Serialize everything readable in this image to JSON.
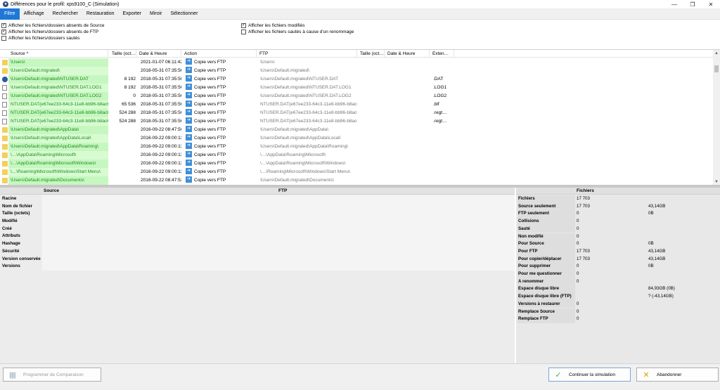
{
  "window": {
    "title": "Différences pour le profil: xps9100_C (Simulation)",
    "controls": [
      "—",
      "❐",
      "✕"
    ]
  },
  "menu": [
    "Filtre",
    "Affichage",
    "Rechercher",
    "Restauration",
    "Exporter",
    "Miroir",
    "Sélectionner"
  ],
  "filters": {
    "left": [
      {
        "label": "Afficher les fichiers/dossiers absents de Source",
        "checked": true
      },
      {
        "label": "Afficher les fichiers/dossiers absents de FTP",
        "checked": true
      },
      {
        "label": "Afficher les fichiers/dossiers sautés",
        "checked": false
      }
    ],
    "right": [
      {
        "label": "Afficher les fichiers modifiés",
        "checked": true
      },
      {
        "label": "Afficher les fichiers sautés à cause d'un renommage",
        "checked": false
      }
    ]
  },
  "grid": {
    "columns": [
      "Source",
      "Taille (oct…",
      "Date & Heure",
      "Action",
      "FTP",
      "Taille (oct…",
      "Date & Heure",
      "Exten…"
    ],
    "sort_indicator": "^",
    "rows": [
      {
        "icon": "folder",
        "source": "\\Users\\",
        "size": "",
        "date": "2021-01-07 06:11:42",
        "action": "Copie vers FTP",
        "ftp": "\\Users\\",
        "ext": ""
      },
      {
        "icon": "folder",
        "source": "\\Users\\Default.migrated\\",
        "size": "",
        "date": "2018-05-31 07:35:56",
        "action": "Copie vers FTP",
        "ftp": "\\Users\\Default.migrated\\",
        "ext": ""
      },
      {
        "icon": "user",
        "source": "\\Users\\Default.migrated\\NTUSER.DAT",
        "size": "8 192",
        "date": "2018-05-31 07:35:56",
        "action": "Copie vers FTP",
        "ftp": "\\Users\\Default.migrated\\NTUSER.DAT",
        "ext": ".DAT"
      },
      {
        "icon": "file",
        "source": "\\Users\\Default.migrated\\NTUSER.DAT.LOG1",
        "size": "8 192",
        "date": "2018-05-31 07:35:56",
        "action": "Copie vers FTP",
        "ftp": "\\Users\\Default.migrated\\NTUSER.DAT.LOG1",
        "ext": ".LOG1"
      },
      {
        "icon": "file",
        "source": "\\Users\\Default.migrated\\NTUSER.DAT.LOG2",
        "size": "0",
        "date": "2018-05-31 07:35:56",
        "action": "Copie vers FTP",
        "ftp": "\\Users\\Default.migrated\\NTUSER.DAT.LOG2",
        "ext": ".LOG2"
      },
      {
        "icon": "file",
        "source": "NTUSER.DAT{e67ee233-64c3-11e8-bb96-b8ac6f",
        "size": "65 536",
        "date": "2018-05-31 07:35:56",
        "action": "Copie vers FTP",
        "ftp": "NTUSER.DAT{e67ee233-64c3-11e8-bb96-b8ac6f",
        "ext": ".blf"
      },
      {
        "icon": "file",
        "source": "NTUSER.DAT{e67ee233-64c3-11e8-bb96-b8ac6f",
        "size": "524 288",
        "date": "2018-05-31 07:35:56",
        "action": "Copie vers FTP",
        "ftp": "NTUSER.DAT{e67ee233-64c3-11e8-bb96-b8ac6f",
        "ext": ".regt…"
      },
      {
        "icon": "file",
        "source": "NTUSER.DAT{e67ee233-64c3-11e8-bb96-b8ac6f",
        "size": "524 288",
        "date": "2018-05-31 07:35:56",
        "action": "Copie vers FTP",
        "ftp": "NTUSER.DAT{e67ee233-64c3-11e8-bb96-b8ac6f",
        "ext": ".regt…"
      },
      {
        "icon": "folder",
        "source": "\\Users\\Default.migrated\\AppData\\",
        "size": "",
        "date": "2016-09-22 08:47:50",
        "action": "Copie vers FTP",
        "ftp": "\\Users\\Default.migrated\\AppData\\",
        "ext": ""
      },
      {
        "icon": "folder",
        "source": "\\Users\\Default.migrated\\AppData\\Local\\",
        "size": "",
        "date": "2016-09-22 09:00:11",
        "action": "Copie vers FTP",
        "ftp": "\\Users\\Default.migrated\\AppData\\Local\\",
        "ext": ""
      },
      {
        "icon": "folder",
        "source": "\\Users\\Default.migrated\\AppData\\Roaming\\",
        "size": "",
        "date": "2016-09-22 09:00:11",
        "action": "Copie vers FTP",
        "ftp": "\\Users\\Default.migrated\\AppData\\Roaming\\",
        "ext": ""
      },
      {
        "icon": "folder",
        "source": "\\…\\AppData\\Roaming\\Microsoft\\",
        "size": "",
        "date": "2016-09-22 09:00:11",
        "action": "Copie vers FTP",
        "ftp": "\\…\\AppData\\Roaming\\Microsoft\\",
        "ext": ""
      },
      {
        "icon": "folder",
        "source": "\\…\\AppData\\Roaming\\Microsoft\\Windows\\",
        "size": "",
        "date": "2016-09-22 09:00:11",
        "action": "Copie vers FTP",
        "ftp": "\\…\\AppData\\Roaming\\Microsoft\\Windows\\",
        "ext": ""
      },
      {
        "icon": "folder",
        "source": "\\…\\Roaming\\Microsoft\\Windows\\Start Menu\\",
        "size": "",
        "date": "2016-09-22 09:00:11",
        "action": "Copie vers FTP",
        "ftp": "\\…\\Roaming\\Microsoft\\Windows\\Start Menu\\",
        "ext": ""
      },
      {
        "icon": "folder",
        "source": "\\Users\\Default.migrated\\Documents\\",
        "size": "",
        "date": "2016-09-22 08:47:52",
        "action": "Copie vers FTP",
        "ftp": "\\Users\\Default.migrated\\Documents\\",
        "ext": ""
      }
    ]
  },
  "details": {
    "source_header": "Source",
    "ftp_header": "FTP",
    "labels": [
      "Racine",
      "Nom de fichier",
      "Taille (octets)",
      "Modifié",
      "Créé",
      "Attributs",
      "Hashage",
      "Sécurité",
      "Version conservée",
      "Versions"
    ]
  },
  "stats": {
    "header": "Fichiers",
    "rows": [
      {
        "label": "Fichiers",
        "count": "17 703",
        "size": ""
      },
      {
        "label": "Source seulement",
        "count": "17 703",
        "size": "43,14GB"
      },
      {
        "label": "FTP seulement",
        "count": "0",
        "size": "0B"
      },
      {
        "label": "Collisions",
        "count": "0",
        "size": ""
      },
      {
        "label": "Sauté",
        "count": "0",
        "size": ""
      },
      {
        "label": "Non modifié",
        "count": "0",
        "size": ""
      },
      {
        "label": "Pour Source",
        "count": "0",
        "size": "0B"
      },
      {
        "label": "Pour FTP",
        "count": "17 703",
        "size": "43,14GB"
      },
      {
        "label": "Pour copier/déplacer",
        "count": "17 703",
        "size": "43,14GB"
      },
      {
        "label": "Pour supprimer",
        "count": "0",
        "size": "0B"
      },
      {
        "label": "Pour me questionner",
        "count": "0",
        "size": ""
      },
      {
        "label": "A renommer",
        "count": "0",
        "size": ""
      },
      {
        "label": "Espace disque libre (Source)",
        "count": "",
        "size": "84,93GB (0B)"
      },
      {
        "label": "Espace disque libre (FTP)",
        "count": "",
        "size": "? (-43,14GB)"
      },
      {
        "label": "Versions à restaurer",
        "count": "0",
        "size": ""
      },
      {
        "label": "Remplace Source",
        "count": "0",
        "size": ""
      },
      {
        "label": "Remplace FTP",
        "count": "0",
        "size": ""
      }
    ]
  },
  "buttons": {
    "schedule": "Programmer de Comparaison",
    "continue": "Continuer la simulation",
    "abandon": "Abandonner"
  }
}
